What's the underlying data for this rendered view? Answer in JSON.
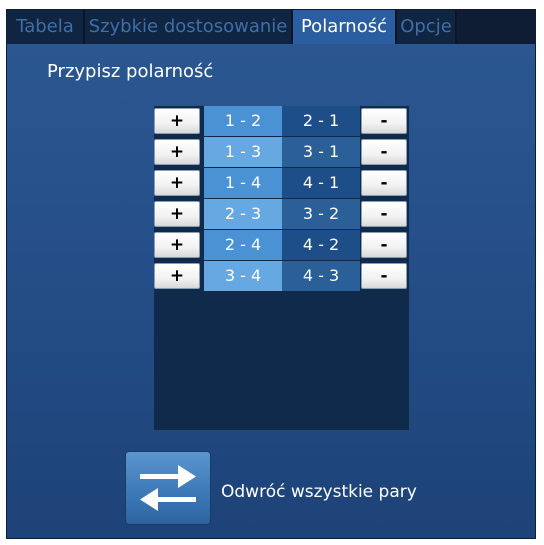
{
  "tabs": [
    {
      "label": "Tabela",
      "active": false
    },
    {
      "label": "Szybkie dostosowanie",
      "active": false
    },
    {
      "label": "Polarność",
      "active": true
    },
    {
      "label": "Opcje",
      "active": false
    }
  ],
  "title": "Przypisz polarność",
  "pairs": [
    {
      "plus": "+",
      "forward": "1 - 2",
      "reverse": "2 - 1",
      "minus": "-"
    },
    {
      "plus": "+",
      "forward": "1 - 3",
      "reverse": "3 - 1",
      "minus": "-"
    },
    {
      "plus": "+",
      "forward": "1 - 4",
      "reverse": "4 - 1",
      "minus": "-"
    },
    {
      "plus": "+",
      "forward": "2 - 3",
      "reverse": "3 - 2",
      "minus": "-"
    },
    {
      "plus": "+",
      "forward": "2 - 4",
      "reverse": "4 - 2",
      "minus": "-"
    },
    {
      "plus": "+",
      "forward": "3 - 4",
      "reverse": "4 - 3",
      "minus": "-"
    }
  ],
  "swap": {
    "icon": "swap-arrows-icon",
    "label": "Odwróć wszystkie pary"
  },
  "colors": {
    "accent": "#2b5ea0",
    "forward_cell": "#4a92d4",
    "reverse_cell": "#1d4e87"
  }
}
